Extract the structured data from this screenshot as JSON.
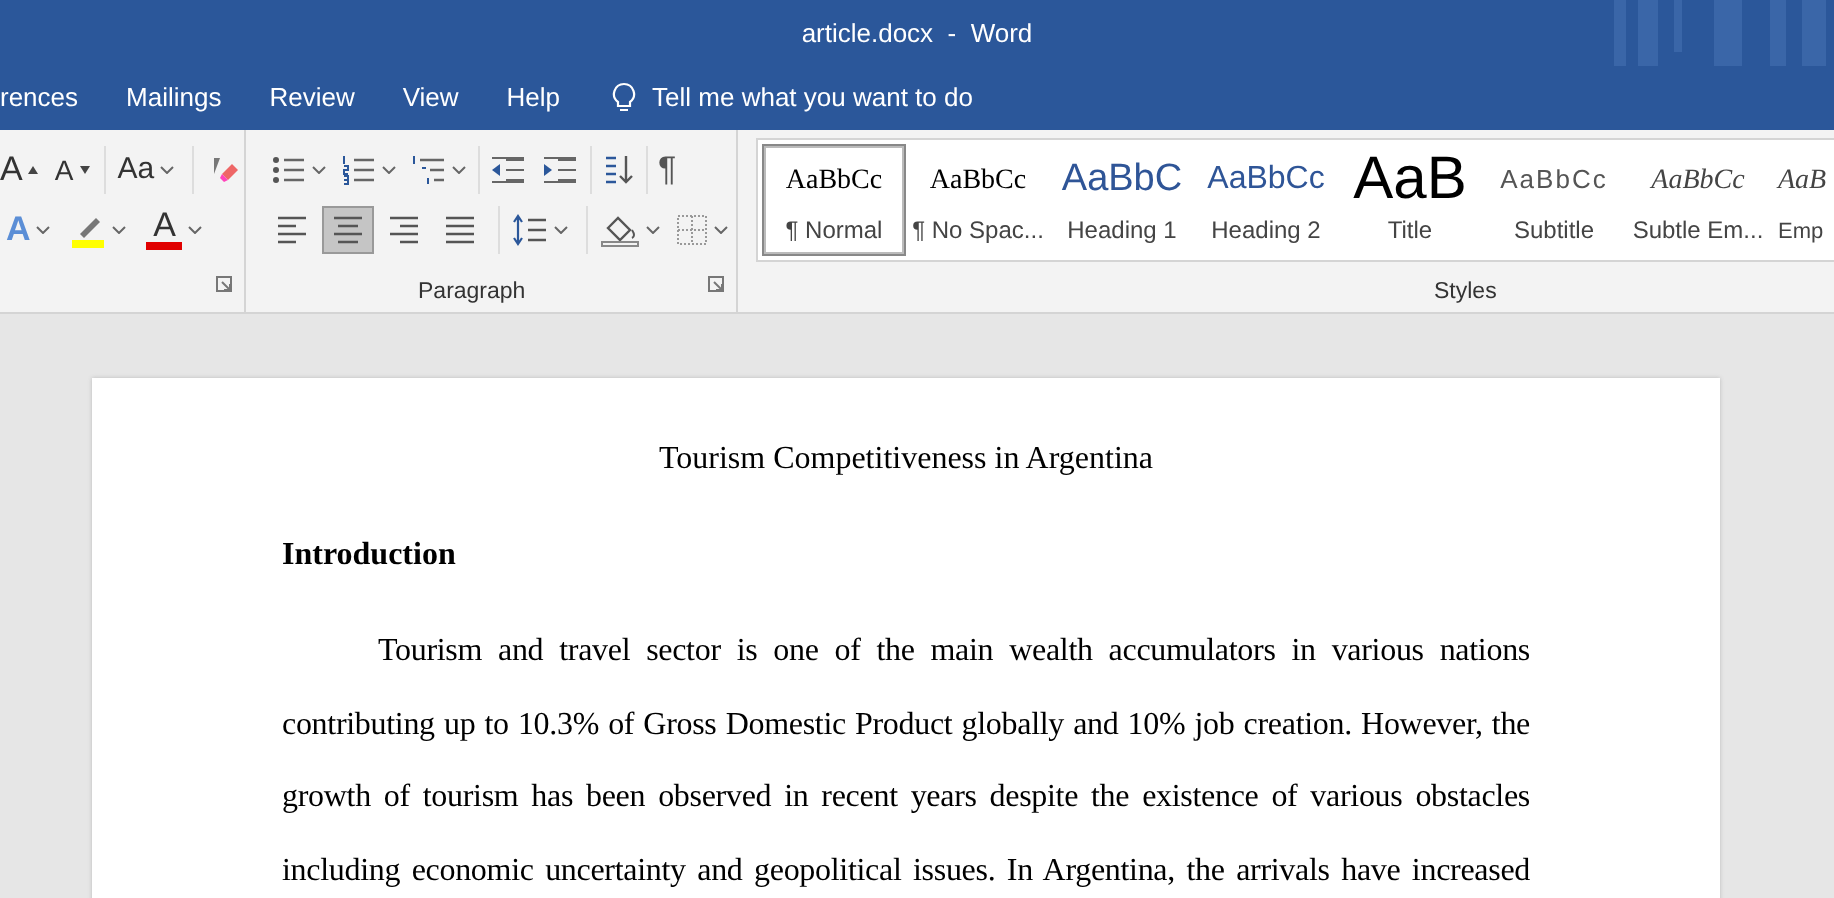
{
  "window": {
    "title": "article.docx  -  Word"
  },
  "tabs": [
    {
      "label": "rences",
      "selected": false
    },
    {
      "label": "Mailings",
      "selected": false
    },
    {
      "label": "Review",
      "selected": false
    },
    {
      "label": "View",
      "selected": false
    },
    {
      "label": "Help",
      "selected": false
    }
  ],
  "tell_me": {
    "placeholder": "Tell me what you want to do"
  },
  "font_group": {
    "grow_glyph": "A",
    "shrink_glyph": "A",
    "case_glyph": "Aa",
    "effects_glyph": "A",
    "color_glyph": "A"
  },
  "paragraph_group": {
    "label": "Paragraph",
    "pilcrow": "¶",
    "alignment": [
      {
        "selected": false
      },
      {
        "selected": true
      },
      {
        "selected": false
      },
      {
        "selected": false
      }
    ]
  },
  "styles_group": {
    "label": "Styles",
    "items": [
      {
        "kind": "normal",
        "sample": "AaBbCc",
        "label": "¶ Normal",
        "selected": true
      },
      {
        "kind": "normal",
        "sample": "AaBbCc",
        "label": "¶ No Spac...",
        "selected": false
      },
      {
        "kind": "heading1",
        "sample": "AaBbC",
        "label": "Heading 1",
        "selected": false
      },
      {
        "kind": "heading2",
        "sample": "AaBbCc",
        "label": "Heading 2",
        "selected": false
      },
      {
        "kind": "title",
        "sample": "AaB",
        "label": "Title",
        "selected": false
      },
      {
        "kind": "subtitle",
        "sample": "AaBbCc",
        "label": "Subtitle",
        "selected": false
      },
      {
        "kind": "emphasis",
        "sample": "AaBbCc",
        "label": "Subtle Em...",
        "selected": false
      },
      {
        "kind": "emphasis",
        "sample": "AaB",
        "label": "Emp",
        "selected": false
      }
    ]
  },
  "document": {
    "title": "Tourism Competitiveness in Argentina",
    "heading": "Introduction",
    "paragraph": "Tourism and travel sector is one of the main wealth accumulators in various nations contributing up to 10.3% of Gross Domestic Product globally and 10% job creation. However, the growth of tourism has been observed in recent years despite the existence of various obstacles including economic uncertainty and geopolitical issues. In Argentina, the arrivals have increased"
  }
}
